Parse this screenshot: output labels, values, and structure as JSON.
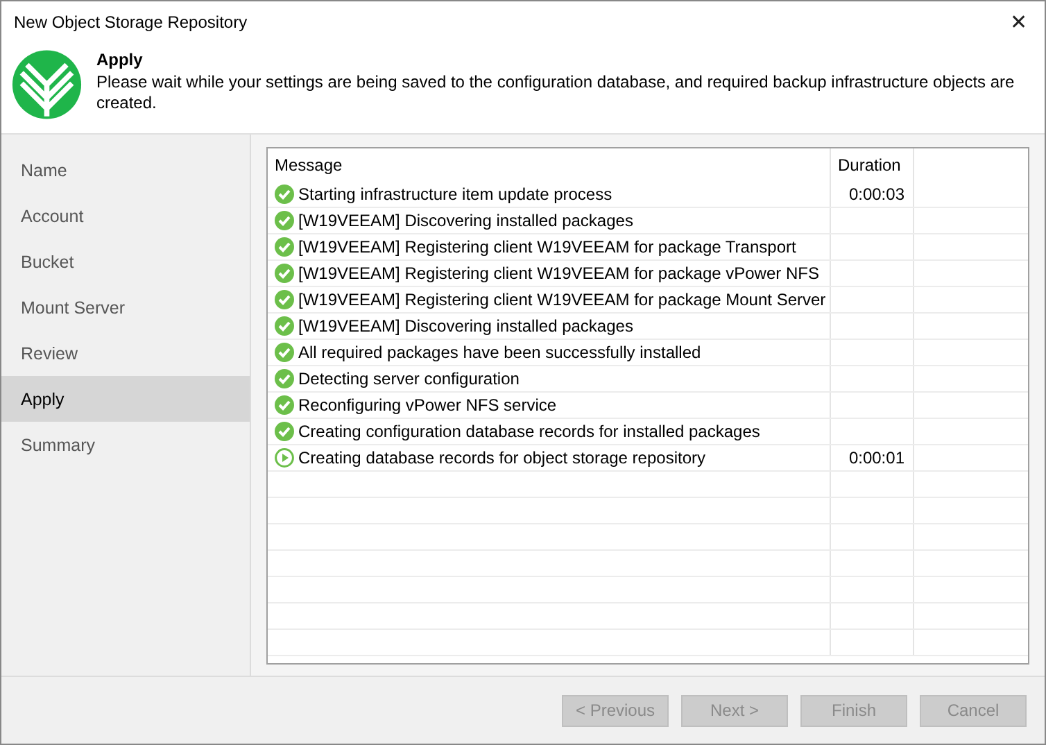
{
  "window": {
    "title": "New Object Storage Repository",
    "close": "✕"
  },
  "header": {
    "title": "Apply",
    "description": "Please wait while your settings are being saved to the configuration database, and required backup infrastructure objects are created."
  },
  "steps": [
    {
      "label": "Name",
      "selected": false
    },
    {
      "label": "Account",
      "selected": false
    },
    {
      "label": "Bucket",
      "selected": false
    },
    {
      "label": "Mount Server",
      "selected": false
    },
    {
      "label": "Review",
      "selected": false
    },
    {
      "label": "Apply",
      "selected": true
    },
    {
      "label": "Summary",
      "selected": false
    }
  ],
  "table": {
    "columns": [
      "Message",
      "Duration"
    ],
    "rows": [
      {
        "kind": "done",
        "message": "Starting infrastructure item update process",
        "duration": "0:00:03"
      },
      {
        "kind": "done",
        "message": "[W19VEEAM] Discovering installed packages"
      },
      {
        "kind": "done",
        "message": "[W19VEEAM] Registering client W19VEEAM for package Transport"
      },
      {
        "kind": "done",
        "message": "[W19VEEAM] Registering client W19VEEAM for package vPower NFS"
      },
      {
        "kind": "done",
        "message": "[W19VEEAM] Registering client W19VEEAM for package Mount Server"
      },
      {
        "kind": "done",
        "message": "[W19VEEAM] Discovering installed packages"
      },
      {
        "kind": "done",
        "message": "All required packages have been successfully installed"
      },
      {
        "kind": "done",
        "message": "Detecting server configuration"
      },
      {
        "kind": "done",
        "message": "Reconfiguring vPower NFS service"
      },
      {
        "kind": "done",
        "message": "Creating configuration database records for installed packages"
      },
      {
        "kind": "running",
        "message": "Creating database records for object storage repository",
        "duration": "0:00:01"
      }
    ]
  },
  "buttons": [
    {
      "label": "< Previous",
      "disabled": true
    },
    {
      "label": "Next >",
      "disabled": true
    },
    {
      "label": "Finish",
      "disabled": true
    },
    {
      "label": "Cancel",
      "disabled": true
    }
  ]
}
